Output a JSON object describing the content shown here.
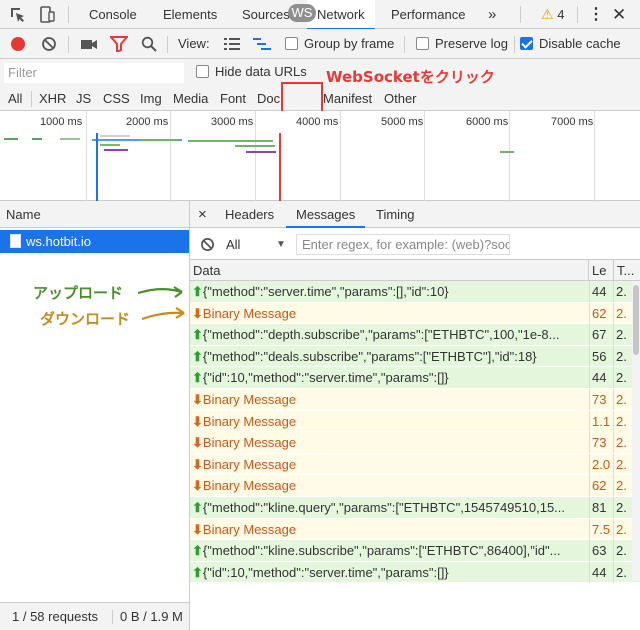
{
  "tabs": {
    "items": [
      "Console",
      "Elements",
      "Sources",
      "Network",
      "Performance"
    ],
    "active": "Network",
    "more": "»",
    "warning_count": "4"
  },
  "toolbar": {
    "view_label": "View:",
    "group_by_frame": "Group by frame",
    "preserve_log": "Preserve log",
    "disable_cache": "Disable cache",
    "disable_cache_checked": true
  },
  "filter": {
    "placeholder": "Filter",
    "hide_data_urls": "Hide data URLs"
  },
  "types": [
    "All",
    "XHR",
    "JS",
    "CSS",
    "Img",
    "Media",
    "Font",
    "Doc",
    "WS",
    "Manifest",
    "Other"
  ],
  "annotations": {
    "ws_click": "WebSocketをクリック",
    "upload": "アップロード",
    "download": "ダウンロード"
  },
  "overview": {
    "ticks": [
      "1000 ms",
      "2000 ms",
      "3000 ms",
      "4000 ms",
      "5000 ms",
      "6000 ms",
      "7000 ms"
    ]
  },
  "requests": {
    "header": "Name",
    "items": [
      "ws.hotbit.io"
    ],
    "footer_requests": "1 / 58 requests",
    "footer_size": "0 B / 1.9 M"
  },
  "detail": {
    "close": "×",
    "tabs": [
      "Headers",
      "Messages",
      "Timing"
    ],
    "active_tab": "Messages",
    "msg_filter_select": "All",
    "regex_placeholder": "Enter regex, for example: (web)?socket",
    "columns": [
      "Data",
      "Le",
      "T..."
    ],
    "messages": [
      {
        "dir": "up",
        "data": "{\"method\":\"server.time\",\"params\":[],\"id\":10}",
        "len": "44",
        "time": "2."
      },
      {
        "dir": "down",
        "data": "Binary Message",
        "len": "62",
        "time": "2."
      },
      {
        "dir": "up",
        "data": "{\"method\":\"depth.subscribe\",\"params\":[\"ETHBTC\",100,\"1e-8...",
        "len": "67",
        "time": "2."
      },
      {
        "dir": "up",
        "data": "{\"method\":\"deals.subscribe\",\"params\":[\"ETHBTC\"],\"id\":18}",
        "len": "56",
        "time": "2."
      },
      {
        "dir": "up",
        "data": "{\"id\":10,\"method\":\"server.time\",\"params\":[]}",
        "len": "44",
        "time": "2."
      },
      {
        "dir": "down",
        "data": "Binary Message",
        "len": "73",
        "time": "2."
      },
      {
        "dir": "down",
        "data": "Binary Message",
        "len": "1.1",
        "time": "2."
      },
      {
        "dir": "down",
        "data": "Binary Message",
        "len": "73",
        "time": "2."
      },
      {
        "dir": "down",
        "data": "Binary Message",
        "len": "2.0",
        "time": "2."
      },
      {
        "dir": "down",
        "data": "Binary Message",
        "len": "62",
        "time": "2."
      },
      {
        "dir": "up",
        "data": "{\"method\":\"kline.query\",\"params\":[\"ETHBTC\",1545749510,15...",
        "len": "81",
        "time": "2."
      },
      {
        "dir": "down",
        "data": "Binary Message",
        "len": "7.5",
        "time": "2."
      },
      {
        "dir": "up",
        "data": "{\"method\":\"kline.subscribe\",\"params\":[\"ETHBTC\",86400],\"id\"...",
        "len": "63",
        "time": "2."
      },
      {
        "dir": "up",
        "data": "{\"id\":10,\"method\":\"server.time\",\"params\":[]}",
        "len": "44",
        "time": "2."
      }
    ]
  }
}
